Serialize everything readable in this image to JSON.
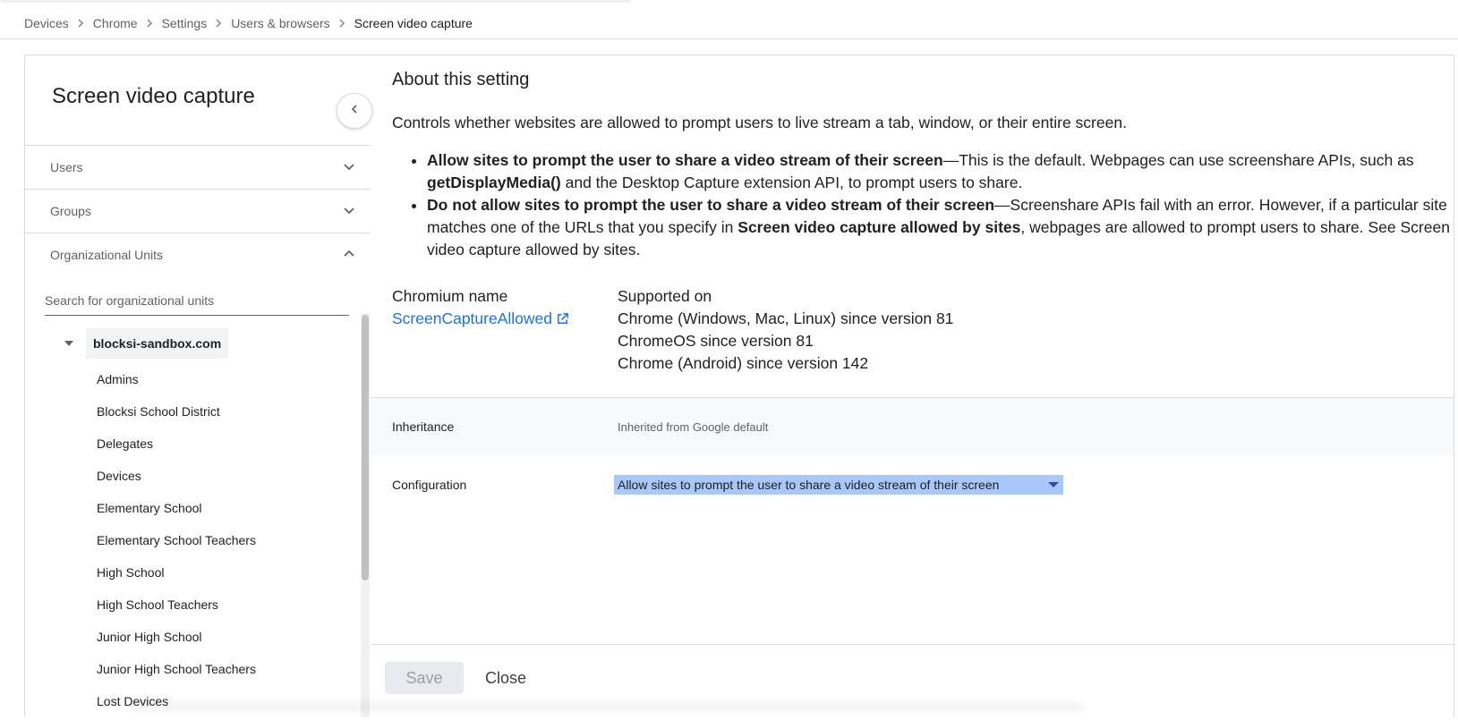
{
  "breadcrumb": {
    "items": [
      "Devices",
      "Chrome",
      "Settings",
      "Users & browsers"
    ],
    "current": "Screen video capture"
  },
  "left_panel": {
    "title": "Screen video capture",
    "sections": {
      "users": "Users",
      "groups": "Groups",
      "org_units": "Organizational Units"
    },
    "search": {
      "placeholder": "Search for organizational units",
      "value": ""
    },
    "tree": {
      "root": "blocksi-sandbox.com",
      "children": [
        "Admins",
        "Blocksi School District",
        "Delegates",
        "Devices",
        "Elementary School",
        "Elementary School Teachers",
        "High School",
        "High School Teachers",
        "Junior High School",
        "Junior High School Teachers",
        "Lost Devices"
      ]
    }
  },
  "setting": {
    "about_title": "About this setting",
    "description": "Controls whether websites are allowed to prompt users to live stream a tab, window, or their entire screen.",
    "bullet1": {
      "bold": "Allow sites to prompt the user to share a video stream of their screen",
      "text1": "—This is the default. Webpages can use screenshare APIs, such as ",
      "bold2": "getDisplayMedia()",
      "text2": " and the Desktop Capture extension API, to prompt users to share."
    },
    "bullet2": {
      "bold": "Do not allow sites to prompt the user to share a video stream of their screen",
      "text1": "—Screenshare APIs fail with an error. However, if a particular site matches one of the URLs that you specify in ",
      "bold2": "Screen video capture allowed by sites",
      "text2": ", webpages are allowed to prompt users to share. See Screen video capture allowed by sites."
    },
    "chromium_name_label": "Chromium name",
    "chromium_name": "ScreenCaptureAllowed",
    "supported_on_label": "Supported on",
    "supported_on": [
      "Chrome (Windows, Mac, Linux) since version 81",
      "ChromeOS since version 81",
      "Chrome (Android) since version 142"
    ],
    "inheritance_label": "Inheritance",
    "inheritance_value": "Inherited from Google default",
    "configuration_label": "Configuration",
    "configuration_value": "Allow sites to prompt the user to share a video stream of their screen"
  },
  "footer": {
    "save_label": "Save",
    "close_label": "Close"
  },
  "colors": {
    "link": "#1a73e8",
    "select_bg": "#a8c7fa",
    "selected_chip": "#f1f3f4",
    "inheritance_bg": "#f8f9fa"
  }
}
